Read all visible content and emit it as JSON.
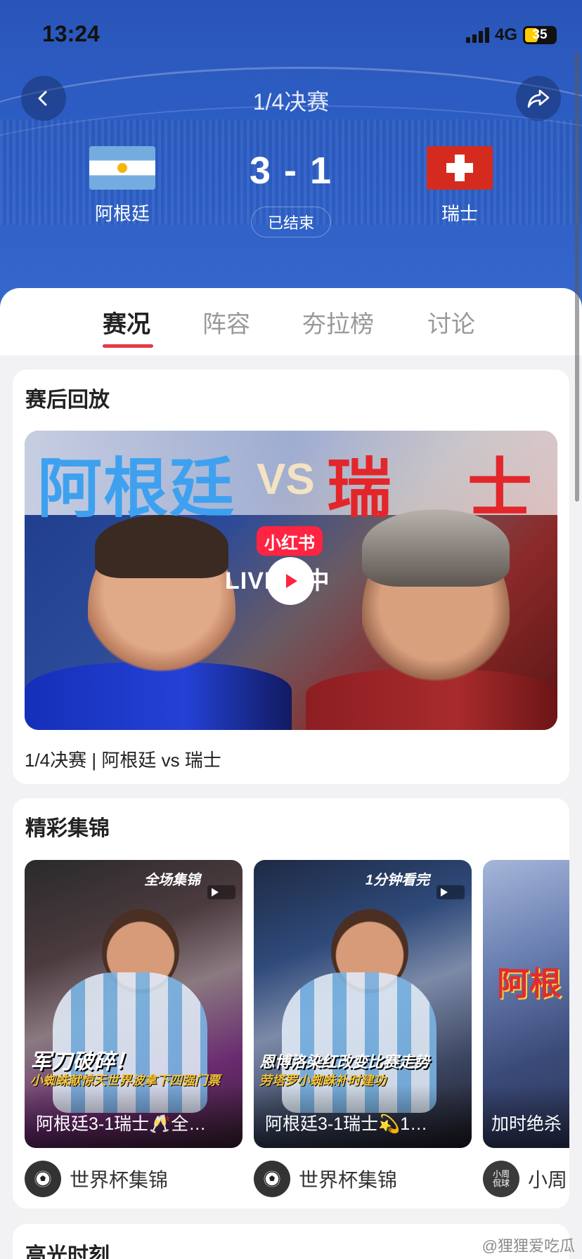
{
  "status_bar": {
    "time": "13:24",
    "network": "4G",
    "battery": "35"
  },
  "header": {
    "round": "1/4决赛",
    "home_team": "阿根廷",
    "away_team": "瑞士",
    "score": "3 - 1",
    "match_status": "已结束"
  },
  "tabs": [
    "赛况",
    "阵容",
    "夯拉榜",
    "讨论"
  ],
  "replay": {
    "section_title": "赛后回放",
    "video_text_left": "阿根廷",
    "video_text_vs": "VS",
    "video_text_right_1": "瑞",
    "video_text_right_2": "士",
    "badge": "小红书",
    "live_text": "LIVE播中",
    "caption": "1/4决赛 | 阿根廷 vs 瑞士"
  },
  "highlights": {
    "section_title": "精彩集锦",
    "items": [
      {
        "tag": "全场集锦",
        "headline": "军刀破碎！",
        "subline": "小蜘蛛献惊天世界波拿下四强门票",
        "title": "阿根廷3-1瑞士🥂全…",
        "author": "世界杯集锦"
      },
      {
        "tag": "1分钟看完",
        "headline": "恩博洛染红改变比赛走势",
        "subline": "劳塔罗小蜘蛛补时建功",
        "title": "阿根廷3-1瑞士💫1…",
        "author": "世界杯集锦"
      },
      {
        "tag": "",
        "headline": "阿根",
        "subline": "",
        "title": "加时绝杀",
        "author": "小周",
        "author_avatar_text": "小周\n侃球"
      }
    ]
  },
  "moments": {
    "section_title": "高光时刻"
  },
  "watermark": "@狸狸爱吃瓜",
  "colors": {
    "accent": "#e53846",
    "header_blue": "#2d5fc6",
    "xhs_red": "#ff2442"
  }
}
